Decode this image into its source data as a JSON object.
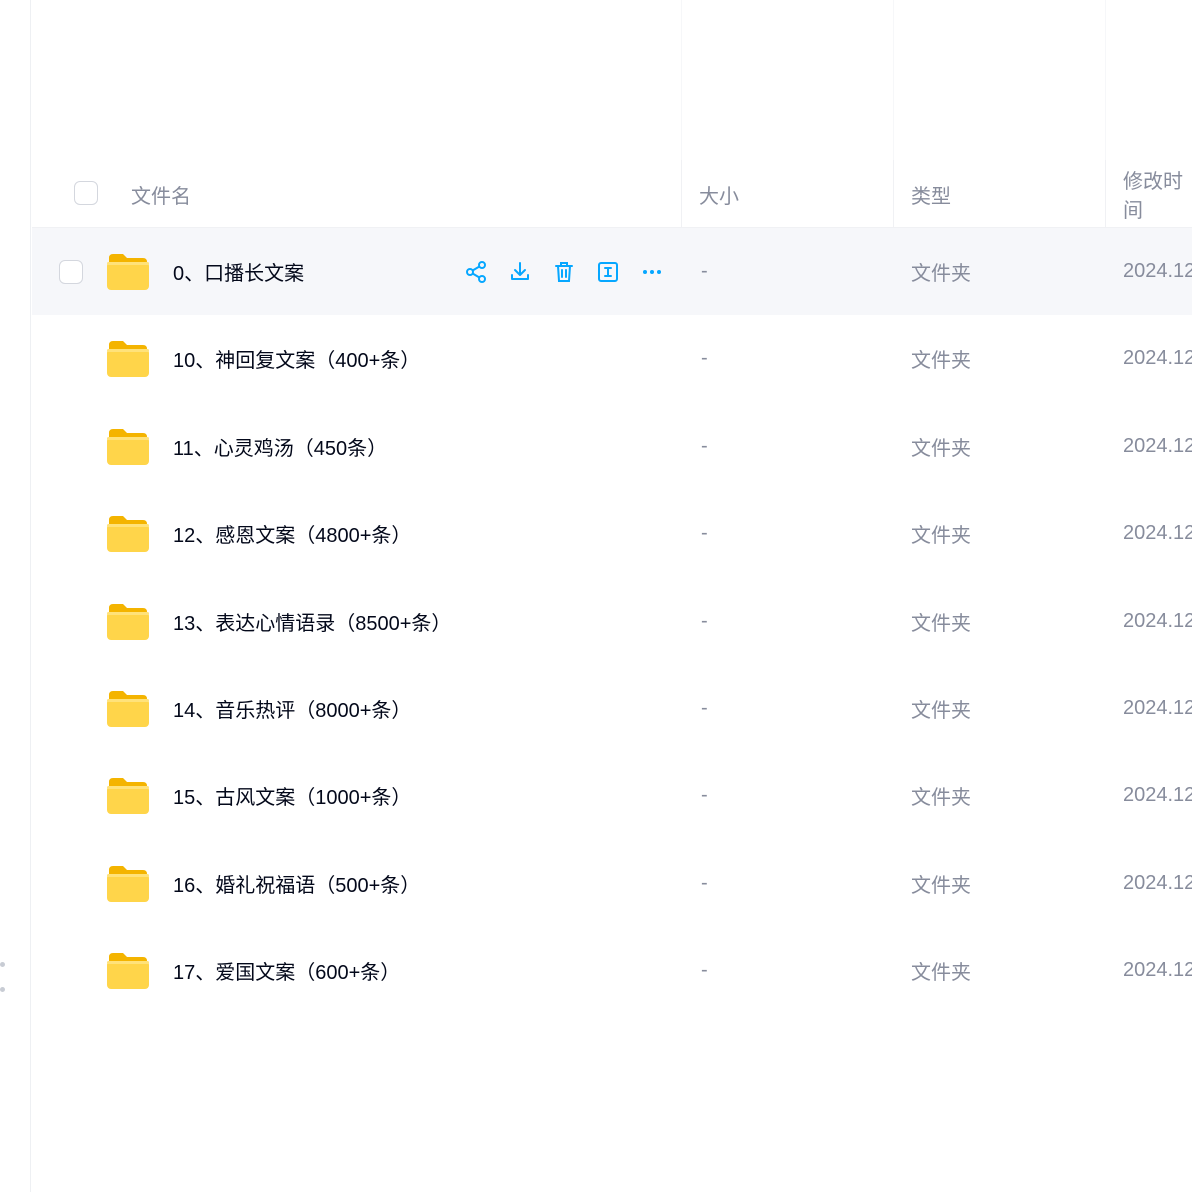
{
  "table": {
    "columns": {
      "name": "文件名",
      "size": "大小",
      "type": "类型",
      "modified": "修改时间"
    },
    "rows": [
      {
        "name": "0、口播长文案",
        "size": "-",
        "type": "文件夹",
        "date": "2024.12",
        "hovered": true
      },
      {
        "name": "10、神回复文案（400+条）",
        "size": "-",
        "type": "文件夹",
        "date": "2024.12"
      },
      {
        "name": "11、心灵鸡汤（450条）",
        "size": "-",
        "type": "文件夹",
        "date": "2024.12"
      },
      {
        "name": "12、感恩文案（4800+条）",
        "size": "-",
        "type": "文件夹",
        "date": "2024.12"
      },
      {
        "name": "13、表达心情语录（8500+条）",
        "size": "-",
        "type": "文件夹",
        "date": "2024.12"
      },
      {
        "name": "14、音乐热评（8000+条）",
        "size": "-",
        "type": "文件夹",
        "date": "2024.12"
      },
      {
        "name": "15、古风文案（1000+条）",
        "size": "-",
        "type": "文件夹",
        "date": "2024.12"
      },
      {
        "name": "16、婚礼祝福语（500+条）",
        "size": "-",
        "type": "文件夹",
        "date": "2024.12"
      },
      {
        "name": "17、爱国文案（600+条）",
        "size": "-",
        "type": "文件夹",
        "date": "2024.12"
      }
    ],
    "row_actions": [
      "share-icon",
      "download-icon",
      "delete-icon",
      "rename-icon",
      "more-icon"
    ]
  },
  "colors": {
    "accent": "#06a7ff",
    "folder": "#ffd54a",
    "hover_row": "#f6f7fa",
    "muted_text": "#878c9c"
  }
}
